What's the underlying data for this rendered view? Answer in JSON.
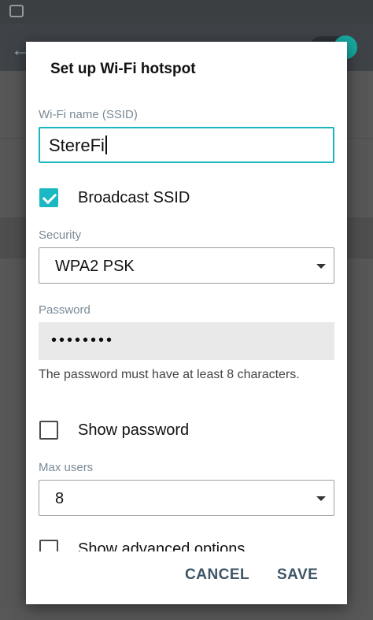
{
  "dialog": {
    "title": "Set up Wi-Fi hotspot",
    "ssid_label": "Wi-Fi name (SSID)",
    "ssid_value": "StereFi",
    "broadcast_label": "Broadcast SSID",
    "broadcast_checked": true,
    "security_label": "Security",
    "security_value": "WPA2 PSK",
    "password_label": "Password",
    "password_value": "••••••••",
    "password_hint": "The password must have at least 8 characters.",
    "show_password_label": "Show password",
    "show_password_checked": false,
    "max_users_label": "Max users",
    "max_users_value": "8",
    "advanced_label": "Show advanced options",
    "cancel_label": "CANCEL",
    "save_label": "SAVE"
  },
  "icons": {
    "back": "arrow-left-icon",
    "checkbox_on": "checkbox-checked-icon",
    "checkbox_off": "checkbox-unchecked-icon",
    "dropdown": "dropdown-arrow-icon"
  },
  "colors": {
    "accent": "#19b8c2",
    "button_text": "#3d5566",
    "label_text": "#7a8a96"
  }
}
